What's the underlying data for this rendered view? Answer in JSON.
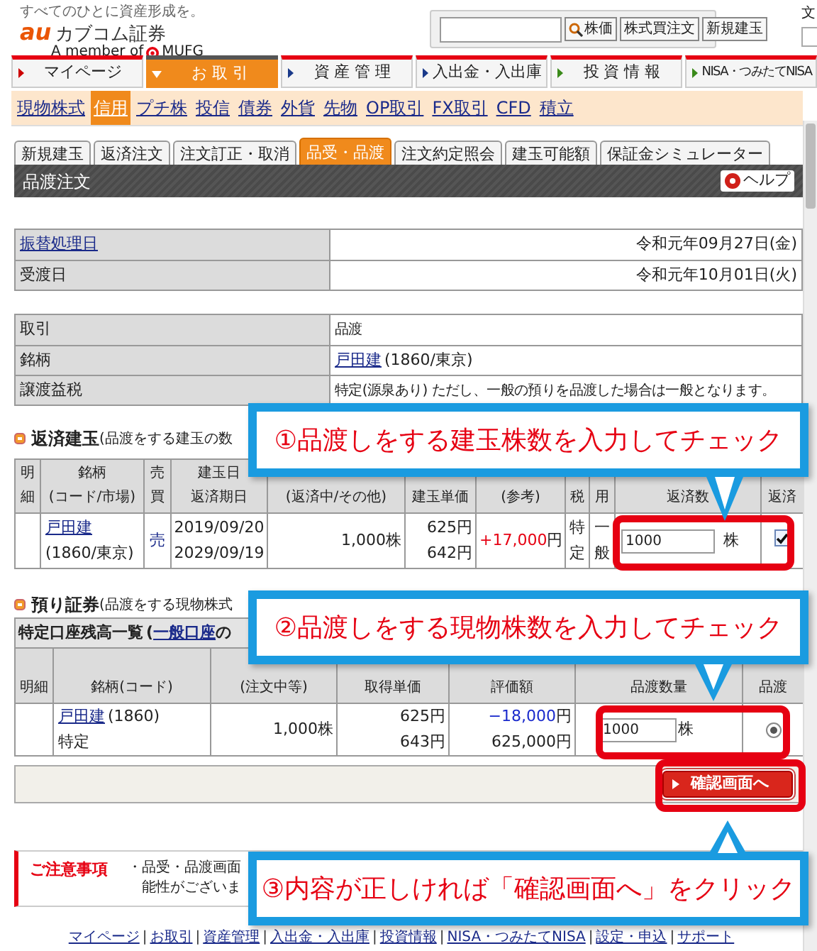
{
  "header": {
    "tagline": "すべてのひとに資産形成を。",
    "logo_mark": "au",
    "logo_text": "カブコム証券",
    "member_text": "A member of",
    "member_brand": "MUFG"
  },
  "search": {
    "buttons": [
      "株価",
      "株式買注文",
      "新規建玉"
    ]
  },
  "font_size_control": {
    "label": "文"
  },
  "main_nav": [
    {
      "label": "マイページ",
      "selected": false
    },
    {
      "label": "お 取 引",
      "selected": true
    },
    {
      "label": "資 産 管 理",
      "selected": false
    },
    {
      "label": "入出金・入出庫",
      "selected": false
    },
    {
      "label": "投 資 情 報",
      "selected": false
    },
    {
      "label": "NISA・つみたてNISA",
      "selected": false
    }
  ],
  "sub_nav": [
    {
      "label": "現物株式",
      "selected": false
    },
    {
      "label": "信用",
      "selected": true
    },
    {
      "label": "プチ株",
      "selected": false
    },
    {
      "label": "投信",
      "selected": false
    },
    {
      "label": "債券",
      "selected": false
    },
    {
      "label": "外貨",
      "selected": false
    },
    {
      "label": "先物",
      "selected": false
    },
    {
      "label": "OP取引",
      "selected": false
    },
    {
      "label": "FX取引",
      "selected": false
    },
    {
      "label": "CFD",
      "selected": false
    },
    {
      "label": "積立",
      "selected": false
    }
  ],
  "tabs": [
    {
      "label": "新規建玉",
      "selected": false
    },
    {
      "label": "返済注文",
      "selected": false
    },
    {
      "label": "注文訂正・取消",
      "selected": false
    },
    {
      "label": "品受・品渡",
      "selected": true
    },
    {
      "label": "注文約定照会",
      "selected": false
    },
    {
      "label": "建玉可能額",
      "selected": false
    },
    {
      "label": "保証金シミュレーター",
      "selected": false
    }
  ],
  "panel": {
    "title": "品渡注文",
    "help": "ヘルプ"
  },
  "dates": [
    {
      "label": "振替処理日",
      "link": true,
      "value": "令和元年09月27日(金)"
    },
    {
      "label": "受渡日",
      "link": false,
      "value": "令和元年10月01日(火)"
    }
  ],
  "order_info": [
    {
      "label": "取引",
      "value": "品渡"
    },
    {
      "label": "銘柄",
      "value_link": "戸田建",
      "value": "(1860/東京)"
    },
    {
      "label": "譲渡益税",
      "value": "特定(源泉あり) ただし、一般の預りを品渡した場合は一般となります。"
    }
  ],
  "positions": {
    "heading": "返済建玉",
    "heading_note": "(品渡をする建玉の数",
    "columns": [
      [
        "明細"
      ],
      [
        "銘柄",
        "(コード/市場)"
      ],
      [
        "売買"
      ],
      [
        "建玉日",
        "返済期日"
      ],
      [
        "(返済中/その他)"
      ],
      [
        "建玉単価"
      ],
      [
        "(参考)"
      ],
      [
        "税"
      ],
      [
        "用"
      ],
      [
        "返済数"
      ],
      [
        "返済"
      ]
    ],
    "rows": [
      {
        "name": "戸田建",
        "code": "(1860/東京)",
        "side": "売",
        "date_open": "2019/09/20",
        "date_due": "2029/09/19",
        "quantity": "1,000株",
        "price": "625円",
        "price_now": "642円",
        "profit": "+17,000",
        "profit_unit": "円",
        "tax": "特定",
        "use": "一般",
        "input": "1000",
        "unit": "株",
        "checked": true
      }
    ]
  },
  "holdings": {
    "heading": "預り証券",
    "heading_note": "(品渡をする現物株式",
    "table_title": "特定口座残高一覧",
    "table_title_open": "(",
    "table_title_link": "一般口座",
    "table_title_tail": "の",
    "columns": [
      [
        "明細"
      ],
      [
        "銘柄(コード)"
      ],
      [
        "(注文中等)"
      ],
      [
        "取得単価"
      ],
      [
        "評価額"
      ],
      [
        "品渡数量"
      ],
      [
        "品渡"
      ]
    ],
    "rows": [
      {
        "name": "戸田建",
        "code": "(1860)",
        "account": "特定",
        "quantity": "1,000株",
        "price": "625円",
        "price_now": "643円",
        "change": "−18,000",
        "change_unit": "円",
        "value": "625,000円",
        "input": "1000",
        "unit": "株",
        "selected": true
      }
    ]
  },
  "confirm_button": "確認画面へ",
  "notice": {
    "title": "ご注意事項",
    "lines": [
      "・品受・品渡画面",
      "能性がございま"
    ]
  },
  "callouts": [
    "①品渡しをする建玉株数を入力してチェック",
    "②品渡しをする現物株数を入力してチェック",
    "③内容が正しければ「確認画面へ」をクリック"
  ],
  "footer_separator": "|",
  "footer_links": [
    "マイページ",
    "お取引",
    "資産管理",
    "入出金・入出庫",
    "投資情報",
    "NISA・つみたてNISA",
    "設定・申込",
    "サポート"
  ]
}
